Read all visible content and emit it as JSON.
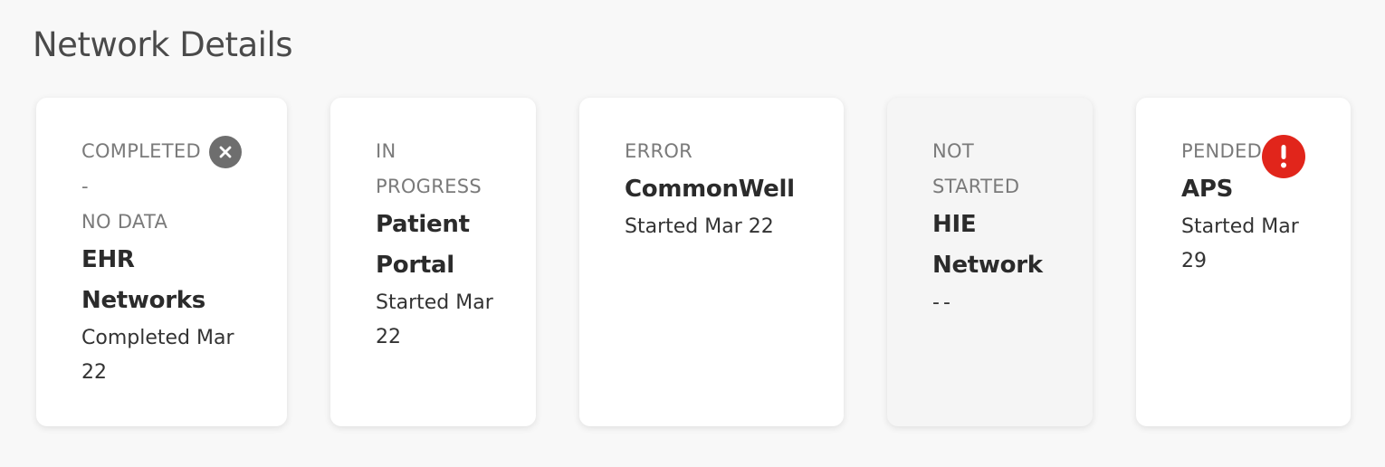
{
  "page": {
    "title": "Network Details"
  },
  "colors": {
    "error_badge": "#e1251b",
    "no_data_badge": "#6e6e6e"
  },
  "cards": [
    {
      "status": "COMPLETED\n-\nNO DATA",
      "name": "EHR Networks",
      "date": "Completed Mar 22",
      "badge_icon": "close-circle-icon"
    },
    {
      "status": "IN\nPROGRESS",
      "name": "Patient Portal",
      "date": "Started Mar 22"
    },
    {
      "status": "ERROR",
      "name": "CommonWell",
      "date": "Started Mar 22"
    },
    {
      "status": "NOT\nSTARTED",
      "name": "HIE Network",
      "date": "--"
    },
    {
      "status": "PENDED",
      "name": "APS",
      "date": "Started Mar 29",
      "badge_icon": "exclamation-circle-icon"
    }
  ]
}
